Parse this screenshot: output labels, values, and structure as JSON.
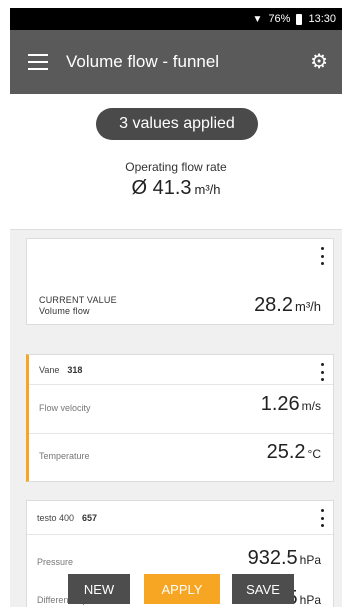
{
  "status_bar": {
    "battery": "76%",
    "time": "13:30"
  },
  "app_bar": {
    "title": "Volume flow - funnel"
  },
  "summary": {
    "applied_badge": "3 values applied",
    "operating_label": "Operating flow rate",
    "operating_value": "Ø 41.3",
    "operating_unit": "m³/h"
  },
  "current_card": {
    "label_line1": "CURRENT VALUE",
    "label_line2": "Volume flow",
    "value": "28.2",
    "unit": "m³/h"
  },
  "vane_card": {
    "device": "Vane",
    "device_id": "318",
    "rows": [
      {
        "label": "Flow velocity",
        "value": "1.26",
        "unit": "m/s"
      },
      {
        "label": "Temperature",
        "value": "25.2",
        "unit": "°C"
      }
    ]
  },
  "testo_card": {
    "device": "testo 400",
    "device_id": "657",
    "rows": [
      {
        "label": "Pressure",
        "value": "932.5",
        "unit": "hPa"
      },
      {
        "label": "Differential pressure",
        "value": "0.015",
        "unit": "hPa"
      }
    ]
  },
  "buttons": {
    "new": "NEW",
    "apply": "APPLY",
    "save": "SAVE"
  },
  "colors": {
    "accent": "#f6a623",
    "appbar": "#5a5a5a",
    "button_dark": "#4d4d4d"
  }
}
